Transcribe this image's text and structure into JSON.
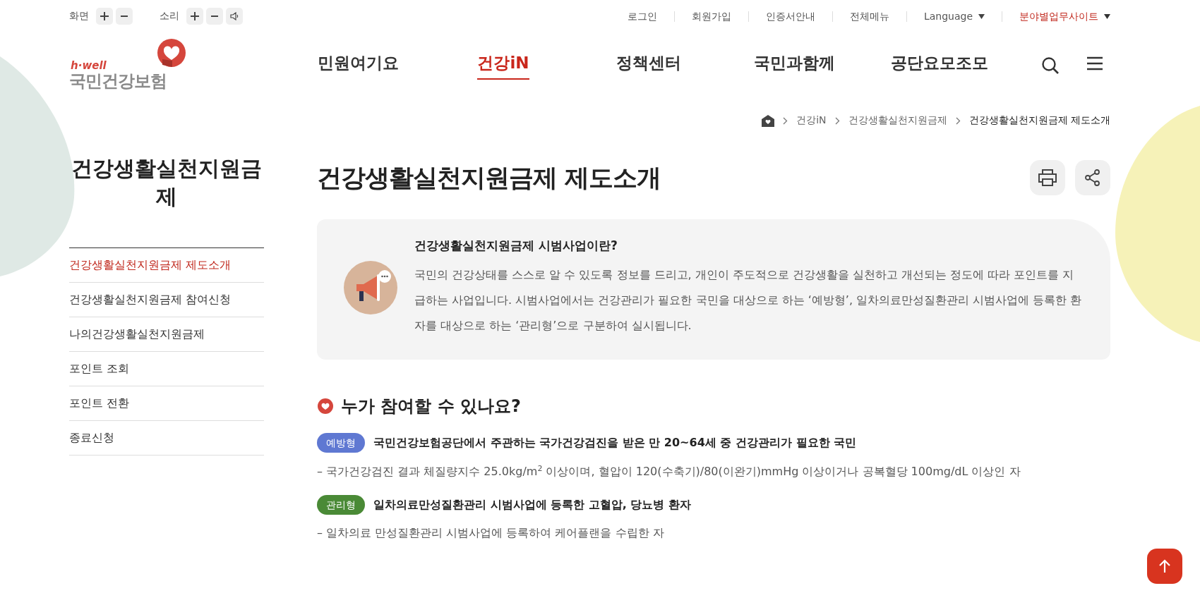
{
  "utility": {
    "screen_label": "화면",
    "sound_label": "소리",
    "links": [
      "로그인",
      "회원가입",
      "인증서안내",
      "전체메뉴"
    ],
    "language": "Language",
    "sites": "분야별업무사이트"
  },
  "logo": {
    "tagline": "h·well",
    "name": "국민건강보험"
  },
  "nav": [
    {
      "label": "민원여기요",
      "selected": false
    },
    {
      "label": "건강iN",
      "selected": true
    },
    {
      "label": "정책센터",
      "selected": false
    },
    {
      "label": "국민과함께",
      "selected": false
    },
    {
      "label": "공단요모조모",
      "selected": false
    }
  ],
  "breadcrumb": [
    "건강iN",
    "건강생활실천지원금제",
    "건강생활실천지원금제 제도소개"
  ],
  "sidebar": {
    "title": "건강생활실천지원금제",
    "items": [
      {
        "label": "건강생활실천지원금제 제도소개",
        "selected": true
      },
      {
        "label": "건강생활실천지원금제 참여신청",
        "selected": false
      },
      {
        "label": "나의건강생활실천지원금제",
        "selected": false
      },
      {
        "label": "포인트 조회",
        "selected": false
      },
      {
        "label": "포인트 전환",
        "selected": false
      },
      {
        "label": "종료신청",
        "selected": false
      }
    ]
  },
  "page_title": "건강생활실천지원금제 제도소개",
  "info": {
    "title": "건강생활실천지원금제 시범사업이란?",
    "body": "국민의 건강상태를 스스로 알 수 있도록 정보를 드리고, 개인이 주도적으로 건강생활을 실천하고 개선되는 정도에 따라 포인트를 지급하는 사업입니다. 시범사업에서는 건강관리가 필요한 국민을 대상으로 하는 ‘예방형’, 일차의료만성질환관리 시범사업에 등록한 환자를 대상으로 하는 ‘관리형’으로 구분하여 실시됩니다."
  },
  "section": {
    "heading": "누가 참여할 수 있나요?",
    "groups": [
      {
        "badge": "예방형",
        "color": "#5f78d2",
        "statement": "국민건강보험공단에서 주관하는 국가건강검진을 받은 만 20~64세 중 건강관리가 필요한 국민",
        "detail": "– 국가건강검진 결과 체질량지수 25.0kg/m$^{2}$ 이상이며, 혈압이 120(수축기)/80(이완기)mmHg 이상이거나 공복혈당 100mg/dL 이상인 자"
      },
      {
        "badge": "관리형",
        "color": "#4a8a36",
        "statement": "일차의료만성질환관리 시범사업에 등록한 고혈압, 당뇨병 환자",
        "detail": "– 일차의료 만성질환관리 시범사업에 등록하여 케어플랜을 수립한 자"
      }
    ]
  }
}
